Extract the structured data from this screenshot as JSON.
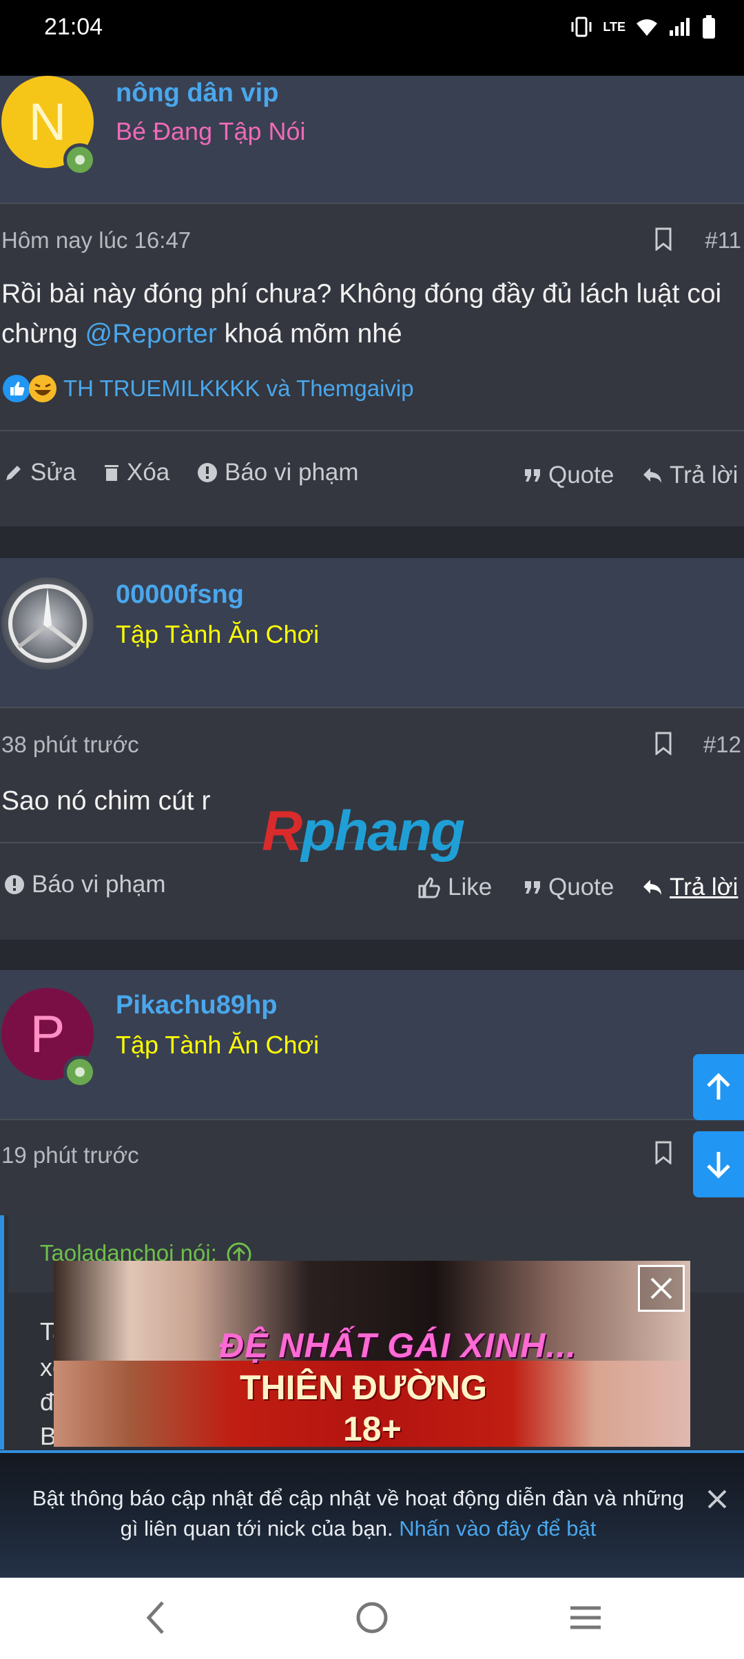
{
  "status": {
    "time": "21:04",
    "network": "LTE"
  },
  "posts": [
    {
      "username": "nông dân vip",
      "user_title": "Bé Đang Tập Nói",
      "user_title_color": "#f06ab7",
      "avatar_letter": "N",
      "avatar_color": "#f5c518",
      "avatar_text_color": "#fff6c2",
      "time": "Hôm nay lúc 16:47",
      "number": "#11",
      "text_pre": "Rồi bài này đóng phí chưa? Không đóng đầy đủ lách luật coi chừng ",
      "mention": "@Reporter",
      "text_post": " khoá mõm nhé",
      "reactions": "TH TRUEMILKKKK và Themgaivip",
      "actions": {
        "edit": "Sửa",
        "delete": "Xóa",
        "report": "Báo vi phạm",
        "quote": "Quote",
        "reply": "Trả lời"
      }
    },
    {
      "username": "00000fsng",
      "user_title": "Tập Tành Ăn Chơi",
      "user_title_color": "#ffff00",
      "time": "38 phút trước",
      "number": "#12",
      "text": "Sao nó chim cút r",
      "actions": {
        "report": "Báo vi phạm",
        "like": "Like",
        "quote": "Quote",
        "reply": "Trả lời"
      }
    },
    {
      "username": "Pikachu89hp",
      "user_title": "Tập Tành Ăn Chơi",
      "user_title_color": "#ffff00",
      "avatar_letter": "P",
      "avatar_color": "#7a0f45",
      "avatar_text_color": "#ff8fc4",
      "time": "19 phút trước",
      "quote_author": "Taoladanchoi nói:",
      "quote_lines": [
        "Ta",
        "xc",
        "đ",
        "B"
      ]
    }
  ],
  "watermark": {
    "a": "R",
    "rest": "phang"
  },
  "ad": {
    "line1": "ĐỆ NHẤT GÁI XINH...",
    "line2": "THIÊN ĐƯỜNG",
    "line3": "18+"
  },
  "notification": {
    "message": "Bật thông báo cập nhật để cập nhật về hoạt động diễn đàn và những gì liên quan tới nick của bạn.",
    "link": "Nhấn vào đây để bật"
  }
}
